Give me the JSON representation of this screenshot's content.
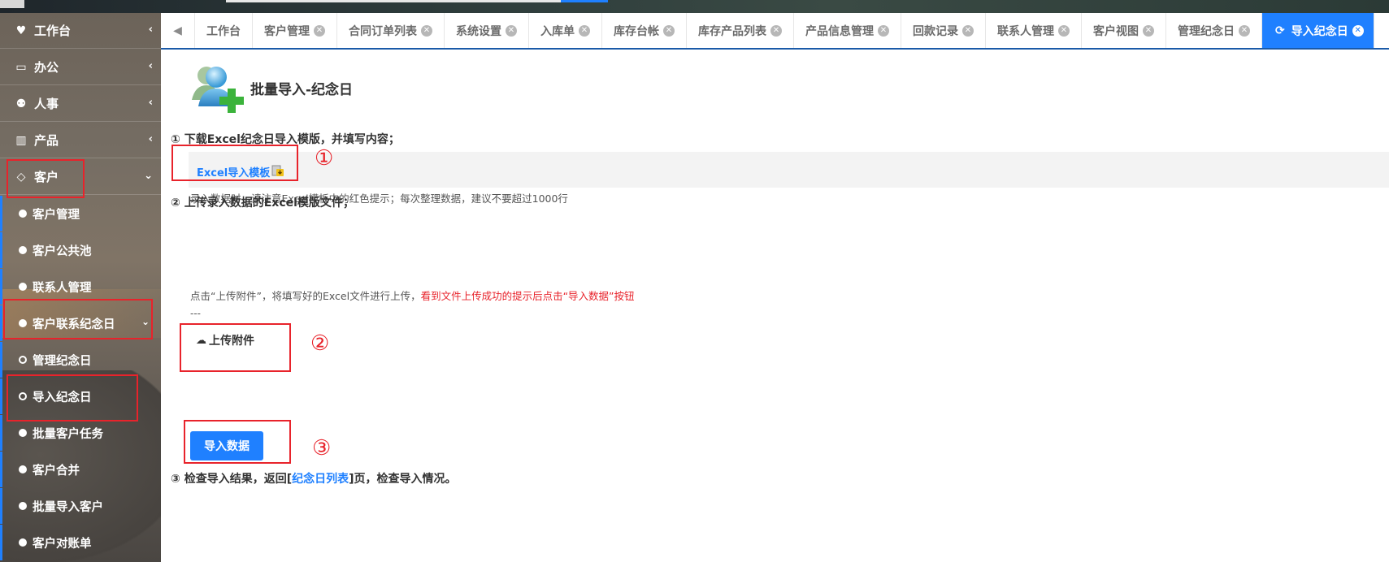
{
  "sidebar": {
    "groups": [
      {
        "label": "工作台",
        "icon": "heart-icon",
        "glyph": "♥"
      },
      {
        "label": "办公",
        "icon": "laptop-icon",
        "glyph": "💻"
      },
      {
        "label": "人事",
        "icon": "users-icon",
        "glyph": "👥"
      },
      {
        "label": "产品",
        "icon": "barcode-icon",
        "glyph": "▥"
      },
      {
        "label": "客户",
        "icon": "diamond-icon",
        "glyph": "◇"
      }
    ],
    "items": [
      {
        "label": "客户管理"
      },
      {
        "label": "客户公共池"
      },
      {
        "label": "联系人管理"
      },
      {
        "label": "客户联系纪念日"
      },
      {
        "label": "管理纪念日"
      },
      {
        "label": "导入纪念日"
      },
      {
        "label": "批量客户任务"
      },
      {
        "label": "客户合并"
      },
      {
        "label": "批量导入客户"
      },
      {
        "label": "客户对账单"
      }
    ]
  },
  "tabs": [
    {
      "label": "工作台",
      "closable": false
    },
    {
      "label": "客户管理",
      "closable": true
    },
    {
      "label": "合同订单列表",
      "closable": true
    },
    {
      "label": "系统设置",
      "closable": true
    },
    {
      "label": "入库单",
      "closable": true
    },
    {
      "label": "库存台帐",
      "closable": true
    },
    {
      "label": "库存产品列表",
      "closable": true
    },
    {
      "label": "产品信息管理",
      "closable": true
    },
    {
      "label": "回款记录",
      "closable": true
    },
    {
      "label": "联系人管理",
      "closable": true
    },
    {
      "label": "客户视图",
      "closable": true
    },
    {
      "label": "管理纪念日",
      "closable": true
    },
    {
      "label": "导入纪念日",
      "closable": true,
      "active": true
    }
  ],
  "main": {
    "title": "批量导入-纪念日",
    "step1": "① 下载Excel纪念日导入模版，并填写内容；",
    "template_link": "Excel导入模板",
    "hint": "录入数据时，请注意Excel模板中的红色提示；每次整理数据，建议不要超过1000行",
    "step2": "② 上传录入数据的Excel模版文件；",
    "upload_note": "点击“上传附件”，将填写好的Excel文件进行上传，",
    "upload_note_red": "看到文件上传成功的提示后点击“导入数据”按钮",
    "dashes": "---",
    "upload_button": "上传附件",
    "import_button": "导入数据",
    "step3_prefix": "③ 检查导入结果，返回[",
    "step3_link": "纪念日列表",
    "step3_suffix": "]页，检查导入情况。"
  },
  "annotations": {
    "mark1": "①",
    "mark2": "②",
    "mark3": "③"
  },
  "colors": {
    "accent": "#1f80ff",
    "annotation": "#e8232b",
    "tab_underline": "#1a5aa8"
  }
}
